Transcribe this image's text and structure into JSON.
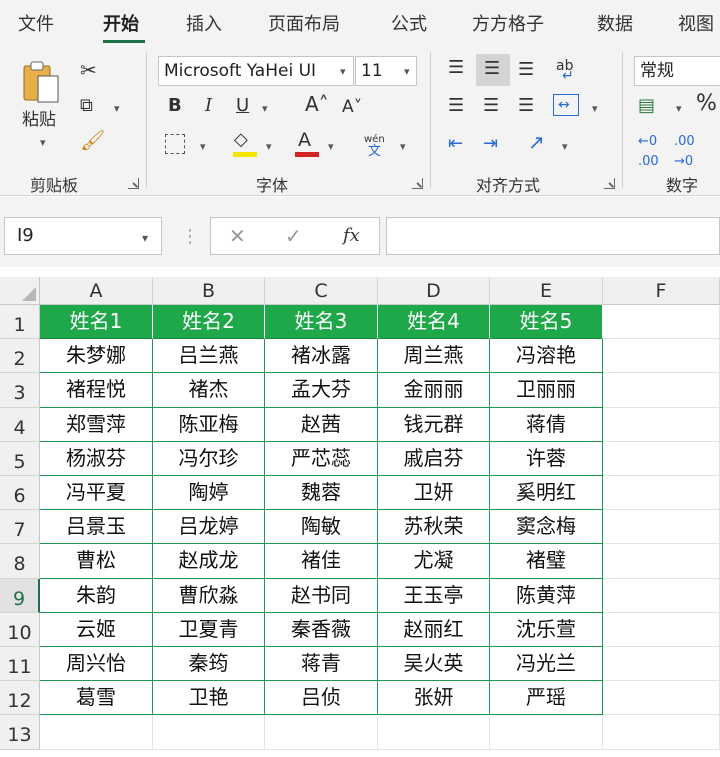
{
  "ribbon_tabs": [
    "文件",
    "开始",
    "插入",
    "页面布局",
    "公式",
    "方方格子",
    "数据",
    "视图"
  ],
  "active_tab": "开始",
  "clipboard": {
    "paste_label": "粘贴",
    "group_label": "剪贴板"
  },
  "font": {
    "font_name": "Microsoft YaHei UI",
    "font_size": "11",
    "group_label": "字体",
    "bold": "B",
    "italic": "I",
    "underline": "U",
    "grow": "A˄",
    "shrink": "A˅",
    "font_color": "A",
    "phonetic_top": "wén",
    "phonetic_bottom": "文"
  },
  "alignment": {
    "group_label": "对齐方式",
    "wrap": "ab"
  },
  "number": {
    "format": "常规",
    "group_label": "数字",
    "percent": "%"
  },
  "formula_bar": {
    "name_box": "I9",
    "fx": "fx",
    "formula": ""
  },
  "grid": {
    "column_headers": [
      "A",
      "B",
      "C",
      "D",
      "E",
      "F"
    ],
    "row_headers": [
      "1",
      "2",
      "3",
      "4",
      "5",
      "6",
      "7",
      "8",
      "9",
      "10",
      "11",
      "12",
      "13"
    ],
    "selected_cell": "I9",
    "header_row": [
      "姓名1",
      "姓名2",
      "姓名3",
      "姓名4",
      "姓名5"
    ],
    "rows": [
      [
        "朱梦娜",
        "吕兰燕",
        "褚冰露",
        "周兰燕",
        "冯溶艳"
      ],
      [
        "褚程悦",
        "褚杰",
        "孟大芬",
        "金丽丽",
        "卫丽丽"
      ],
      [
        "郑雪萍",
        "陈亚梅",
        "赵茜",
        "钱元群",
        "蒋倩"
      ],
      [
        "杨淑芬",
        "冯尔珍",
        "严芯蕊",
        "戚启芬",
        "许蓉"
      ],
      [
        "冯平夏",
        "陶婷",
        "魏蓉",
        "卫妍",
        "奚明红"
      ],
      [
        "吕景玉",
        "吕龙婷",
        "陶敏",
        "苏秋荣",
        "窦念梅"
      ],
      [
        "曹松",
        "赵成龙",
        "褚佳",
        "尤凝",
        "褚璧"
      ],
      [
        "朱韵",
        "曹欣淼",
        "赵书同",
        "王玉亭",
        "陈黄萍"
      ],
      [
        "云姬",
        "卫夏青",
        "秦香薇",
        "赵丽红",
        "沈乐萱"
      ],
      [
        "周兴怡",
        "秦筠",
        "蒋青",
        "吴火英",
        "冯光兰"
      ],
      [
        "葛雪",
        "卫艳",
        "吕侦",
        "张妍",
        "严瑶"
      ]
    ]
  },
  "colors": {
    "header_fill": "#1ea84a",
    "table_border": "#1e9a50",
    "accent": "#1e7145"
  }
}
